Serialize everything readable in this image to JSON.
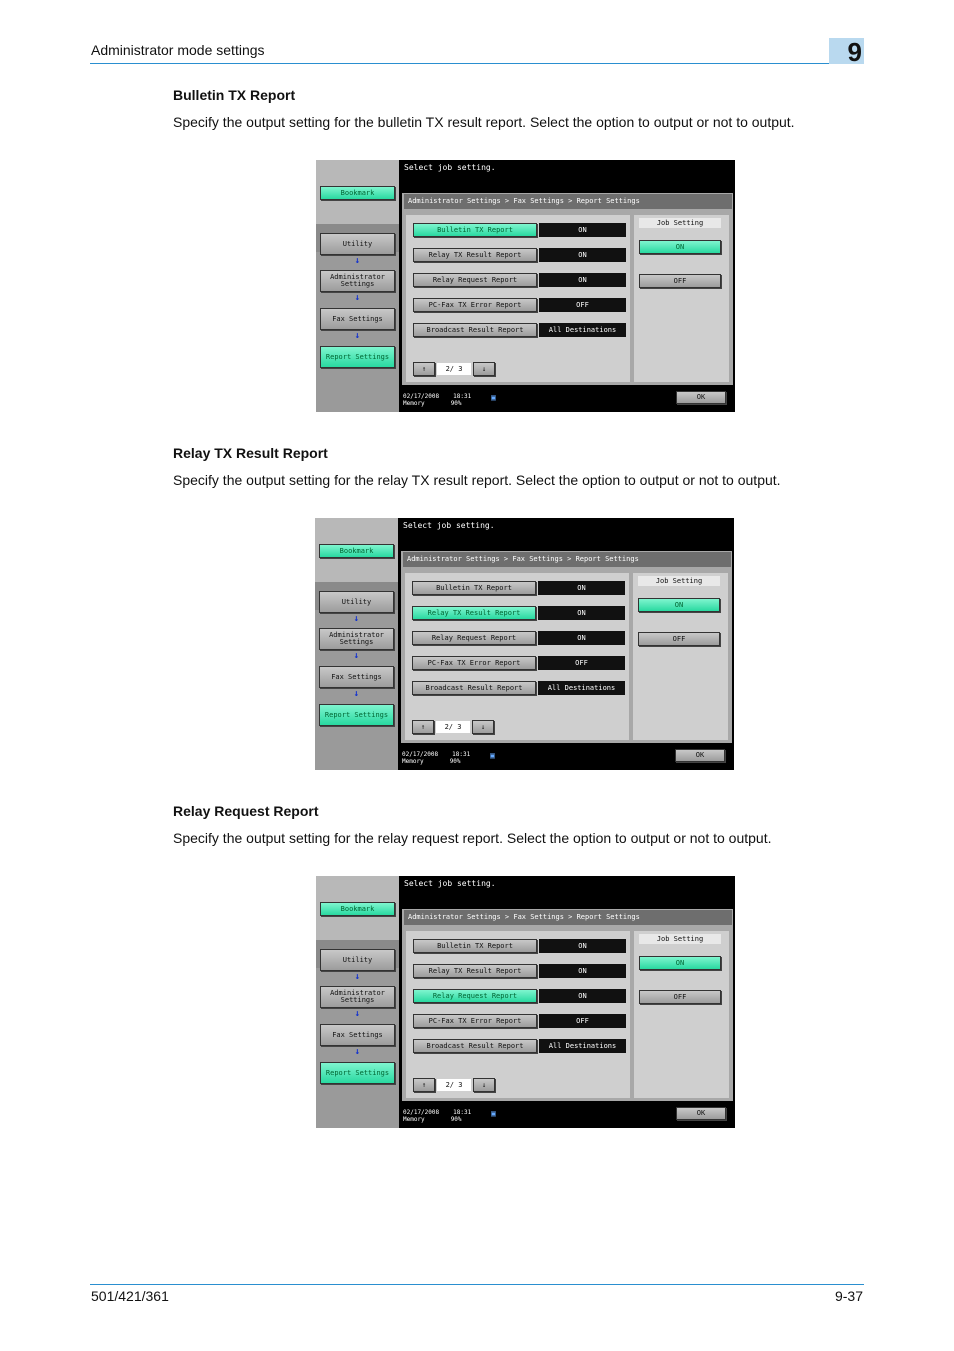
{
  "header": {
    "title": "Administrator mode settings",
    "chapter": "9"
  },
  "sections": [
    {
      "title": "Bulletin TX Report",
      "description": "Specify the output setting for the bulletin TX result report. Select the option to output or not to output.",
      "selected": 0
    },
    {
      "title": "Relay TX Result Report",
      "description": "Specify the output setting for the relay TX result report. Select the option to output or not to output.",
      "selected": 1
    },
    {
      "title": "Relay Request Report",
      "description": "Specify the output setting for the relay request report. Select the option to output or not to output.",
      "selected": 2
    }
  ],
  "screen": {
    "message": "Select job setting.",
    "breadcrumb": "Administrator Settings > Fax Settings > Report Settings",
    "bookmark": "Bookmark",
    "nav": [
      "Utility",
      "Administrator Settings",
      "Fax Settings",
      "Report Settings"
    ],
    "arrow": "↓",
    "rows": [
      {
        "label": "Bulletin TX Report",
        "value": "ON"
      },
      {
        "label": "Relay TX Result Report",
        "value": "ON"
      },
      {
        "label": "Relay Request Report",
        "value": "ON"
      },
      {
        "label": "PC-Fax TX Error Report",
        "value": "OFF"
      },
      {
        "label": "Broadcast Result Report",
        "value": "All Destinations"
      }
    ],
    "job_setting": "Job Setting",
    "on_label": "ON",
    "off_label": "OFF",
    "page_up": "↑",
    "page_down": "↓",
    "page_indicator": "2/ 3",
    "date": "02/17/2008",
    "time": "18:31",
    "memory_label": "Memory",
    "memory_value": "90%",
    "ok_label": "OK",
    "accent_color": "#29d9a0"
  },
  "footer": {
    "model": "501/421/361",
    "page": "9-37"
  }
}
